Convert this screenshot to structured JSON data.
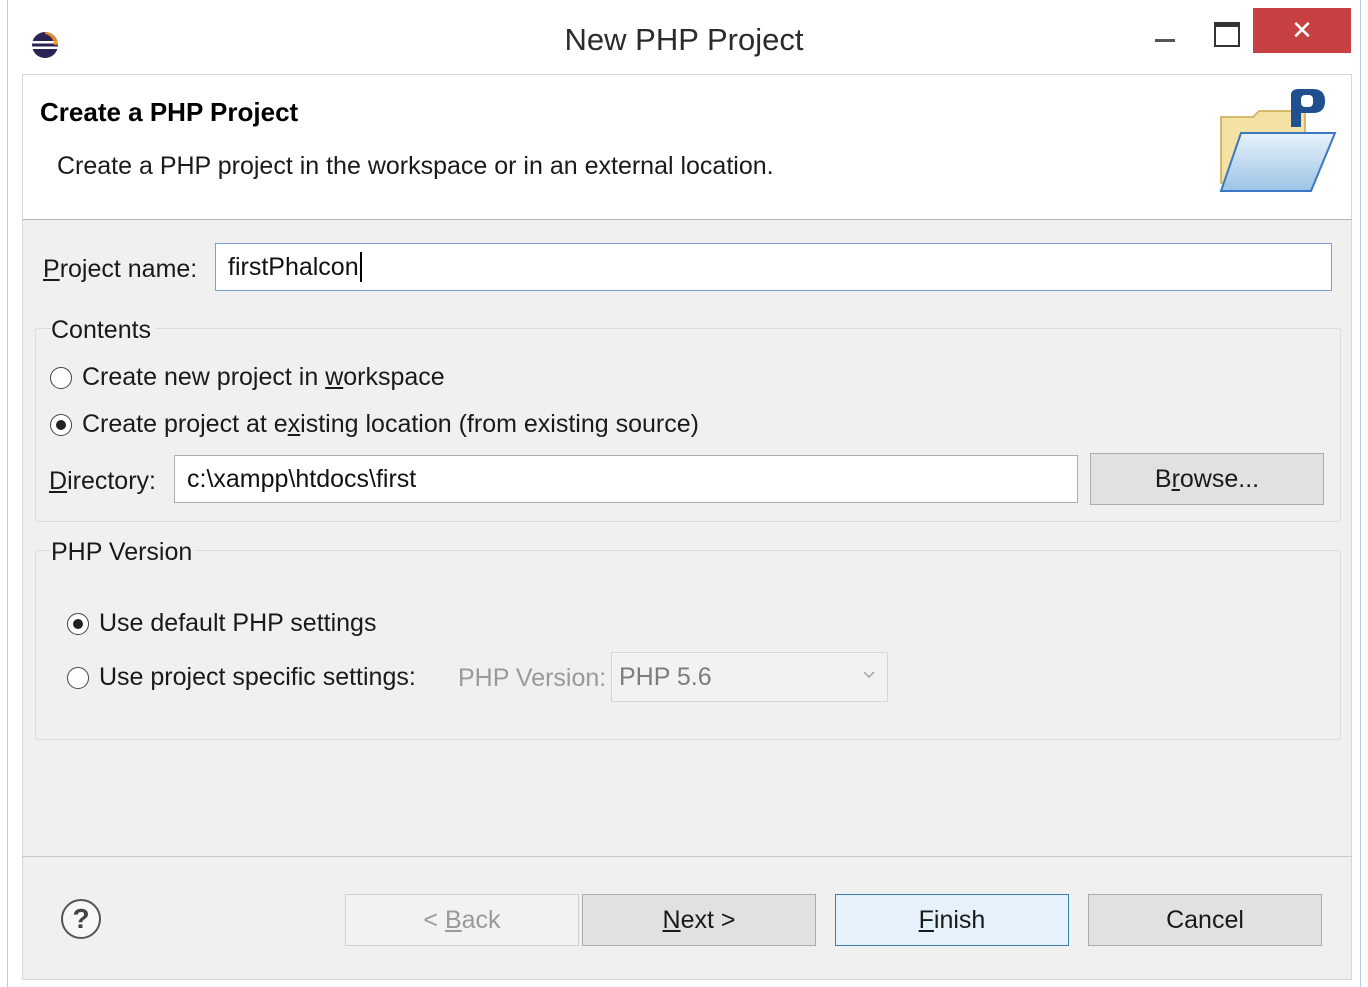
{
  "window": {
    "title": "New PHP Project",
    "close_glyph": "✕"
  },
  "header": {
    "title": "Create a PHP Project",
    "description": "Create a PHP project in the workspace or in an external location.",
    "graphic_letter": "p"
  },
  "project_name": {
    "label_before": "",
    "label_mnemonic": "P",
    "label_after": "roject name:",
    "value": "firstPhalcon"
  },
  "contents": {
    "title": "Contents",
    "option_workspace": {
      "before": "Create new project in ",
      "mnemonic": "w",
      "after": "orkspace",
      "checked": false
    },
    "option_existing": {
      "before": "Create project at e",
      "mnemonic": "x",
      "after": "isting location (from existing source)",
      "checked": true
    },
    "directory_label_mnemonic": "D",
    "directory_label_after": "irectory:",
    "directory_value": "c:\\xampp\\htdocs\\first",
    "browse": {
      "before": "B",
      "mnemonic": "r",
      "after": "owse..."
    }
  },
  "php_version": {
    "title": "PHP Version",
    "option_default": {
      "label": "Use default PHP settings",
      "checked": true
    },
    "option_specific": {
      "label": "Use project specific settings:",
      "checked": false
    },
    "version_label": "PHP Version:",
    "version_value": "PHP 5.6"
  },
  "buttons": {
    "help_glyph": "?",
    "back": {
      "before": "< ",
      "mnemonic": "B",
      "after": "ack"
    },
    "next": {
      "before": "",
      "mnemonic": "N",
      "after": "ext >"
    },
    "finish": {
      "before": "",
      "mnemonic": "F",
      "after": "inish"
    },
    "cancel": "Cancel"
  },
  "colors": {
    "close_button": "#c74142",
    "focus_border": "#7a9fd4",
    "dialog_background": "#f0f0f0"
  }
}
